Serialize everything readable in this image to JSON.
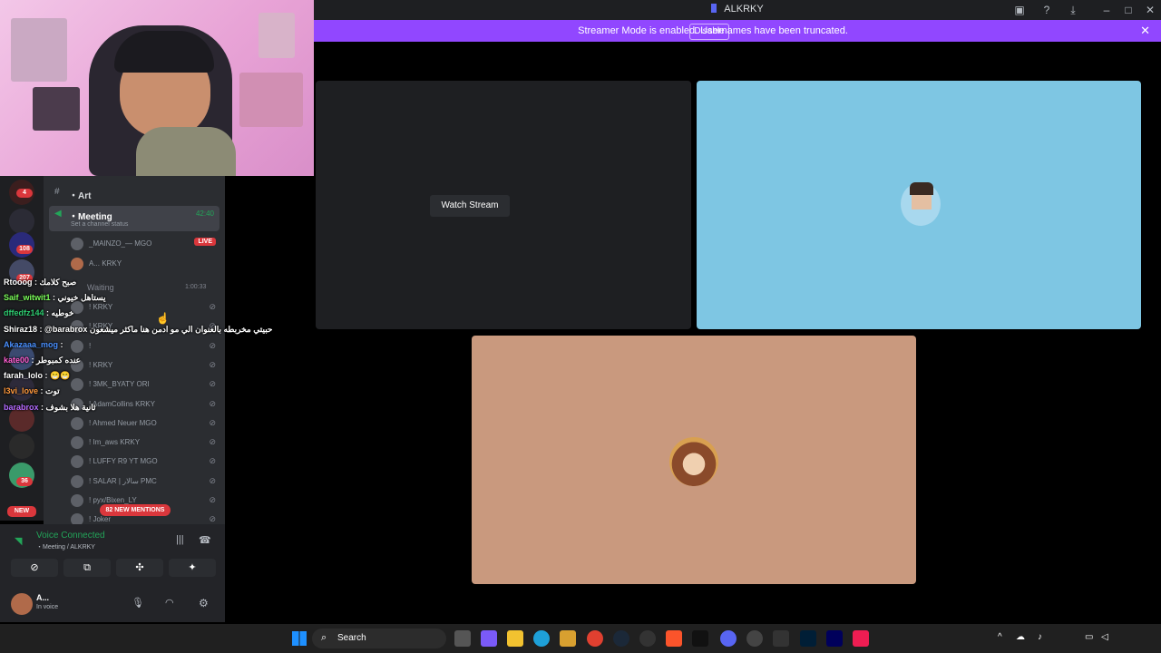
{
  "window": {
    "title": "ALKRKY"
  },
  "banner": {
    "text": "Streamer Mode is enabled. Usernames have been truncated.",
    "disable_label": "Disable"
  },
  "stage": {
    "watch_stream_label": "Watch Stream"
  },
  "channels": {
    "art": "・Art",
    "meeting": "・Meeting",
    "meeting_timer": "42:40",
    "channel_status": "Set a channel status",
    "live_badge": "LIVE",
    "users": [
      {
        "name": "_MAINZO_—",
        "tag": "MGO"
      },
      {
        "name": "A...",
        "tag": "KRKY"
      }
    ],
    "waiting": "Waiting",
    "waiting_timer": "1:00:33",
    "waiting_users": [
      {
        "name": "!",
        "tag": "KRKY"
      },
      {
        "name": "!",
        "tag": "KRKY"
      },
      {
        "name": "!",
        "tag": ""
      },
      {
        "name": "!",
        "tag": "KRKY"
      },
      {
        "name": "! 3MK_BYATY",
        "tag": "ORI"
      },
      {
        "name": "! AdamCollins",
        "tag": "KRKY"
      },
      {
        "name": "! Ahmed Neuer",
        "tag": "MGO"
      },
      {
        "name": "! Im_aws",
        "tag": "KRKY"
      },
      {
        "name": "! LUFFY R9 YT",
        "tag": "MGO"
      },
      {
        "name": "! SALAR | سالار",
        "tag": "PMC"
      },
      {
        "name": "! pyx/Bixen_LY",
        "tag": ""
      },
      {
        "name": "! Joker",
        "tag": ""
      }
    ],
    "new_mentions": "82 NEW MENTIONS"
  },
  "guild_badges": {
    "b1": "4",
    "b2": "108",
    "b3": "207",
    "b4": "36",
    "new": "NEW"
  },
  "voice": {
    "status": "Voice Connected",
    "location": "・Meeting / ALKRKY"
  },
  "user": {
    "name": "A...",
    "status": "In voice"
  },
  "chat": [
    {
      "user": "Rtooog",
      "color": "#ffffff",
      "msg": ": صبح كلامك"
    },
    {
      "user": "Saif_witwit1",
      "color": "#7cff5a",
      "msg": ": يستاهل خيوني"
    },
    {
      "user": "dffedfz144",
      "color": "#2ecc71",
      "msg": ": خوطيه"
    },
    {
      "user": "Shiraz18",
      "color": "#ffffff",
      "msg": ": @barabrox حبيتي مخربطه بالعنوان الي مو ادمن هنا ماكثر ميشعون"
    },
    {
      "user": "Akazaaa_mog",
      "color": "#4a90ff",
      "msg": ":"
    },
    {
      "user": "kate00",
      "color": "#ff5fd2",
      "msg": ": عنده كمبوطر"
    },
    {
      "user": "farah_lolo",
      "color": "#ffffff",
      "msg": ": 😁😁"
    },
    {
      "user": "l3vi_love",
      "color": "#ff9a3c",
      "msg": ": توت"
    },
    {
      "user": "barabrox",
      "color": "#b36bff",
      "msg": ": ثانية هلا بشوف"
    }
  ],
  "taskbar": {
    "search_label": "Search"
  },
  "colors": {
    "accent": "#5865f2",
    "banner": "#9147ff",
    "live": "#da373c",
    "voice_green": "#23a559"
  }
}
